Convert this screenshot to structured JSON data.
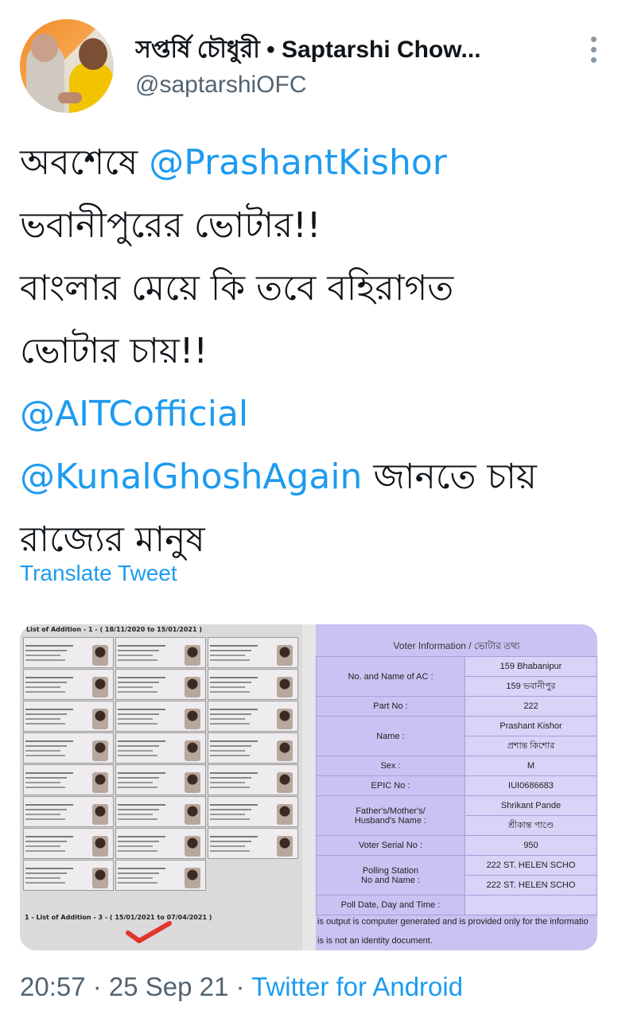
{
  "user": {
    "name": "সপ্তর্ষি চৌধুরী • Saptarshi Chow...",
    "handle": "@saptarshiOFC",
    "avatar_icon": "profile-photo"
  },
  "tweet": {
    "lines": [
      [
        "অবশেষে ",
        "@PrashantKishor"
      ],
      [
        "ভবানীপুরের ভোটার!!"
      ],
      [
        "বাংলার মেয়ে কি তবে বহিরাগত"
      ],
      [
        "ভোটার চায়!!"
      ],
      [
        "@AITCofficial"
      ],
      [
        "@KunalGhoshAgain",
        " জানতে চায়"
      ],
      [
        "রাজ্যের মানুষ"
      ]
    ],
    "mention1": "@PrashantKishor",
    "mention2": "@AITCofficial",
    "mention3": "@KunalGhoshAgain"
  },
  "translate_label": "Translate Tweet",
  "media": {
    "left": {
      "title": "List of Addition - 1 - ( 18/11/2020 to 15/01/2021 )",
      "footer": "1 - List of Addition - 3 - ( 15/01/2021 to 07/04/2021 )"
    },
    "right": {
      "header": "Voter Information / ভোটার তথ্য",
      "ac_label": "No. and Name of AC :",
      "ac_value_en": "159 Bhabanipur",
      "ac_value_bn": "159 ভবানীপুর",
      "part_label": "Part No :",
      "part_value": "222",
      "name_label": "Name :",
      "name_value_en": "Prashant Kishor",
      "name_value_bn": "প্রশান্ত কিশোর",
      "sex_label": "Sex :",
      "sex_value": "M",
      "epic_label": "EPIC No :",
      "epic_value": "IUI0686683",
      "relative_label_1": "Father's/Mother's/",
      "relative_label_2": "Husband's Name :",
      "relative_value_en": "Shrikant Pande",
      "relative_value_bn": "শ্রীকান্ত পাণ্ডে",
      "serial_label": "Voter Serial No :",
      "serial_value": "950",
      "ps_label_1": "Polling Station",
      "ps_label_2": "No and Name :",
      "ps_value_1": "222 ST. HELEN SCHO",
      "ps_value_2": "222 ST. HELEN SCHO",
      "poll_label": "Poll Date, Day and Time :",
      "note1": "is output is computer generated and is provided only for the informatio",
      "note2": "is is not an identity document."
    }
  },
  "meta": {
    "time": "20:57",
    "date": "25 Sep 21",
    "source": "Twitter for Android",
    "sep": " · "
  },
  "colors": {
    "link": "#1d9bf0",
    "muted": "#536471",
    "text": "#0f1419",
    "voter_bg": "#c9c2f2"
  }
}
